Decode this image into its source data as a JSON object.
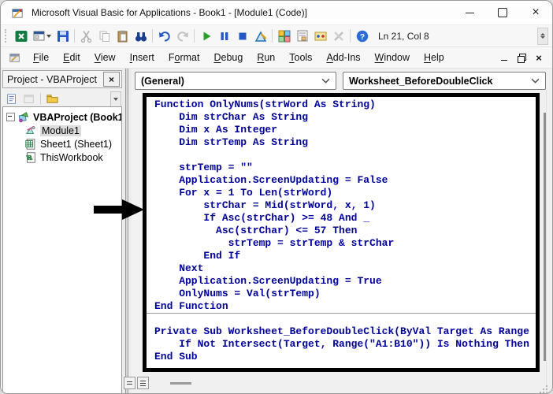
{
  "window": {
    "title": "Microsoft Visual Basic for Applications - Book1 - [Module1 (Code)]"
  },
  "toolbar": {
    "position_label": "Ln 21, Col 8",
    "icons": [
      {
        "name": "view-microsoft-excel-icon"
      },
      {
        "name": "insert-userform-icon",
        "caret": true
      },
      {
        "name": "save-icon"
      },
      {
        "name": "cut-icon",
        "disabled": true,
        "sep_before": true
      },
      {
        "name": "copy-icon",
        "disabled": true
      },
      {
        "name": "paste-icon"
      },
      {
        "name": "find-icon"
      },
      {
        "name": "undo-icon",
        "sep_before": true
      },
      {
        "name": "redo-icon",
        "disabled": true
      },
      {
        "name": "run-icon",
        "sep_before": true
      },
      {
        "name": "break-icon"
      },
      {
        "name": "reset-icon"
      },
      {
        "name": "design-mode-icon"
      },
      {
        "name": "project-explorer-icon",
        "sep_before": true
      },
      {
        "name": "properties-window-icon"
      },
      {
        "name": "object-browser-icon"
      },
      {
        "name": "toolbox-icon",
        "disabled": true
      },
      {
        "name": "help-icon",
        "sep_before": true
      }
    ]
  },
  "menubar": {
    "items": [
      {
        "label": "File",
        "u": 0
      },
      {
        "label": "Edit",
        "u": 0
      },
      {
        "label": "View",
        "u": 0
      },
      {
        "label": "Insert",
        "u": 0
      },
      {
        "label": "Format",
        "u": 1
      },
      {
        "label": "Debug",
        "u": 0
      },
      {
        "label": "Run",
        "u": 0
      },
      {
        "label": "Tools",
        "u": 0
      },
      {
        "label": "Add-Ins",
        "u": 0
      },
      {
        "label": "Window",
        "u": 0
      },
      {
        "label": "Help",
        "u": 0
      }
    ]
  },
  "project_panel": {
    "title": "Project - VBAProject",
    "tree": {
      "root": {
        "label": "VBAProject (Book1",
        "icon": "project-icon"
      },
      "items": [
        {
          "label": "Module1",
          "icon": "module-icon",
          "selected": true
        },
        {
          "label": "Sheet1 (Sheet1)",
          "icon": "sheet-icon"
        },
        {
          "label": "ThisWorkbook",
          "icon": "workbook-icon"
        }
      ]
    }
  },
  "code_window": {
    "object_dropdown": "(General)",
    "procedure_dropdown": "Worksheet_BeforeDoubleClick",
    "code_color": "#00009B",
    "separator_line_index": 17,
    "code_lines": [
      "Function OnlyNums(strWord As String)",
      "    Dim strChar As String",
      "    Dim x As Integer",
      "    Dim strTemp As String",
      "",
      "    strTemp = \"\"",
      "    Application.ScreenUpdating = False",
      "    For x = 1 To Len(strWord)",
      "        strChar = Mid(strWord, x, 1)",
      "        If Asc(strChar) >= 48 And _",
      "          Asc(strChar) <= 57 Then",
      "            strTemp = strTemp & strChar",
      "        End If",
      "    Next",
      "    Application.ScreenUpdating = True",
      "    OnlyNums = Val(strTemp)",
      "End Function",
      "",
      "Private Sub Worksheet_BeforeDoubleClick(ByVal Target As Range",
      "    If Not Intersect(Target, Range(\"A1:B10\")) Is Nothing Then",
      "End Sub"
    ]
  }
}
